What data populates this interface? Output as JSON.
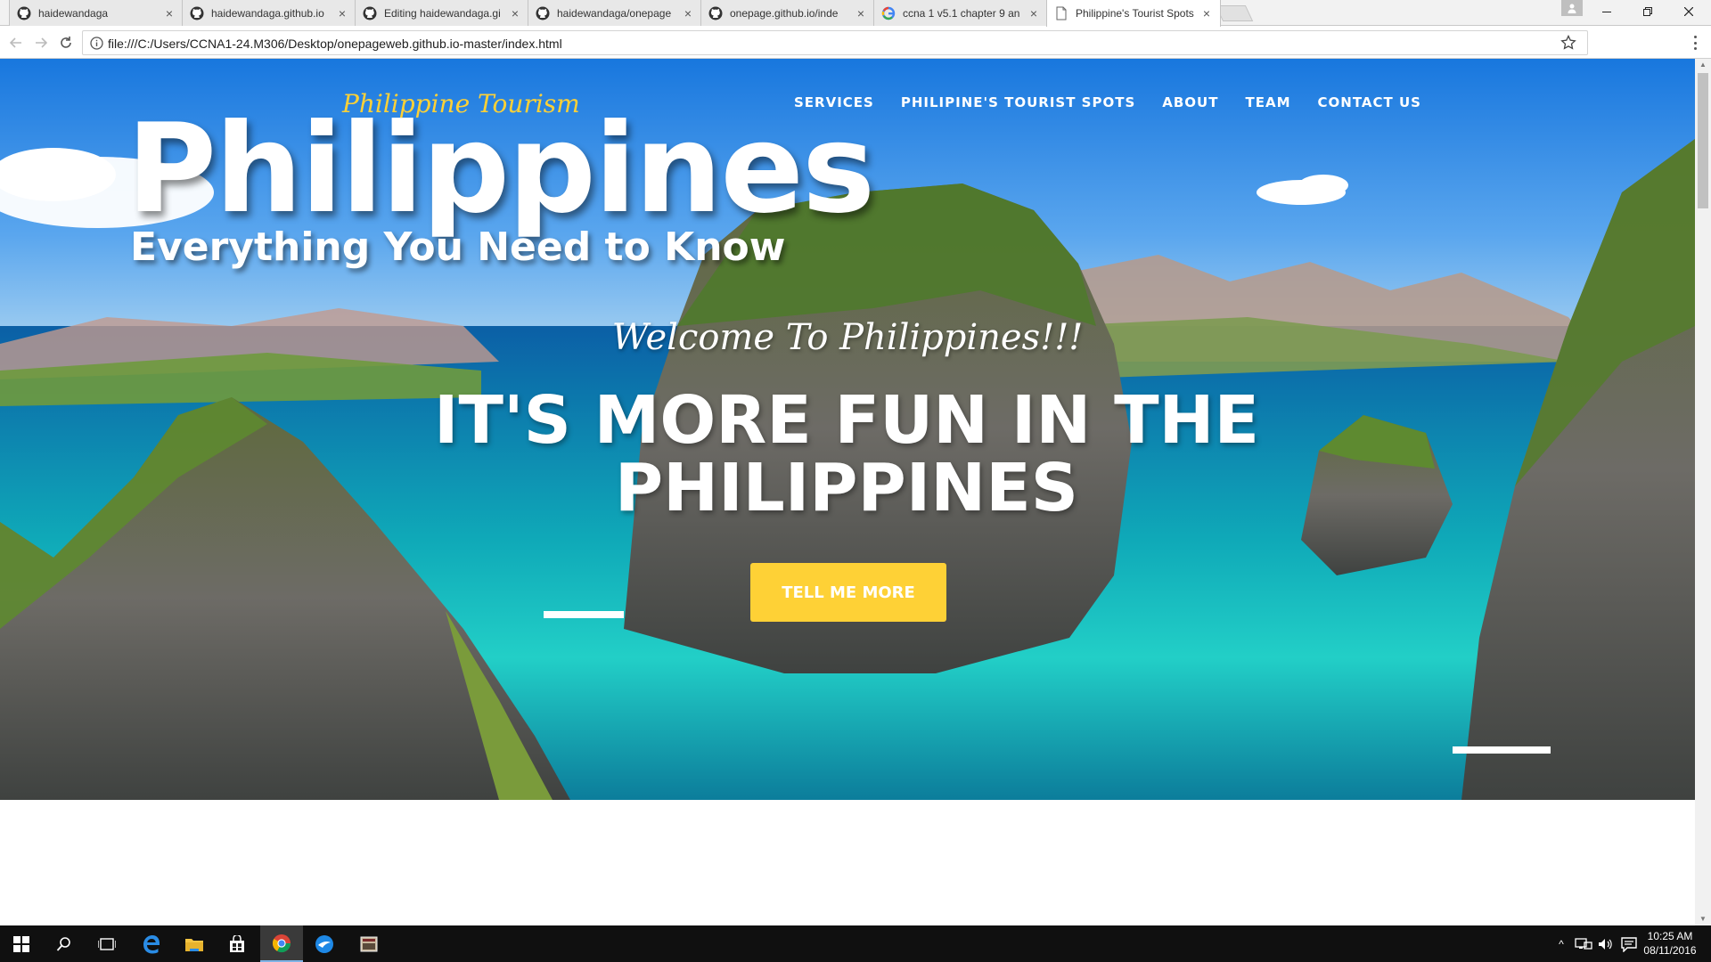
{
  "browser": {
    "tabs": [
      {
        "title": "haidewandaga",
        "icon": "github-icon",
        "active": false
      },
      {
        "title": "haidewandaga.github.io",
        "icon": "github-icon",
        "active": false
      },
      {
        "title": "Editing haidewandaga.gi",
        "icon": "github-icon",
        "active": false
      },
      {
        "title": "haidewandaga/onepage",
        "icon": "github-icon",
        "active": false
      },
      {
        "title": "onepage.github.io/inde",
        "icon": "github-icon",
        "active": false
      },
      {
        "title": "ccna 1 v5.1 chapter 9 an",
        "icon": "google-icon",
        "active": false
      },
      {
        "title": "Philippine's Tourist Spots",
        "icon": "page-icon",
        "active": true
      }
    ],
    "url": "file:///C:/Users/CCNA1-24.M306/Desktop/onepageweb.github.io-master/index.html"
  },
  "site": {
    "logo_title": "Philippines",
    "logo_subtitle": "Everything You Need to Know",
    "brand": "Philippine Tourism",
    "nav": [
      "SERVICES",
      "PHILIPINE'S TOURIST SPOTS",
      "ABOUT",
      "TEAM",
      "CONTACT US"
    ],
    "lead_in": "Welcome To Philippines!!!",
    "heading": "IT'S MORE FUN IN THE PHILIPPINES",
    "cta": "TELL ME MORE"
  },
  "taskbar": {
    "time": "10:25 AM",
    "date": "08/11/2016"
  },
  "colors": {
    "accent": "#fed136"
  }
}
